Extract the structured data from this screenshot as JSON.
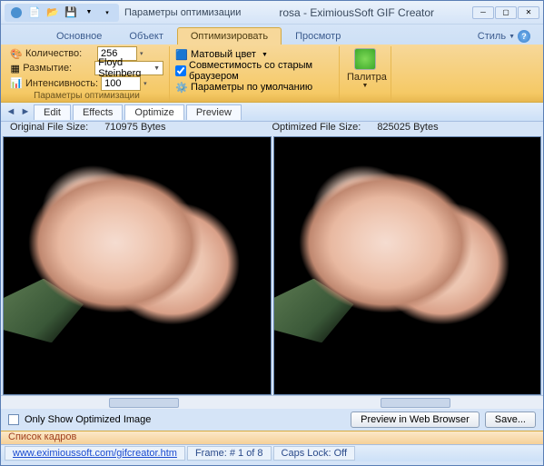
{
  "title": "rosa - EximiousSoft GIF Creator",
  "qat_label": "Параметры оптимизации",
  "ribbon_tabs": [
    "Основное",
    "Объект",
    "Оптимизировать",
    "Просмотр"
  ],
  "ribbon_active": 2,
  "style_label": "Стиль",
  "opt": {
    "quantity_label": "Количество:",
    "quantity_val": "256",
    "blur_label": "Размытие:",
    "blur_val": "Floyd Steinberg",
    "intensity_label": "Интенсивность:",
    "intensity_val": "100",
    "group1_title": "Параметры оптимизации",
    "matte_label": "Матовый цвет",
    "compat_label": "Совместимость со старым браузером",
    "defaults_label": "Параметры по умолчанию",
    "palette_label": "Палитра"
  },
  "view_tabs": [
    "Edit",
    "Effects",
    "Optimize",
    "Preview"
  ],
  "view_active": 2,
  "orig_label": "Original File Size:",
  "orig_val": "710975 Bytes",
  "opt_label": "Optimized File Size:",
  "opt_val": "825025 Bytes",
  "only_opt": "Only Show Optimized Image",
  "preview_btn": "Preview in Web Browser",
  "save_btn": "Save...",
  "frames_title": "Список кадров",
  "status": {
    "url": "www.eximioussoft.com/gifcreator.htm",
    "frame": "Frame: # 1 of 8",
    "caps": "Caps Lock: Off"
  }
}
